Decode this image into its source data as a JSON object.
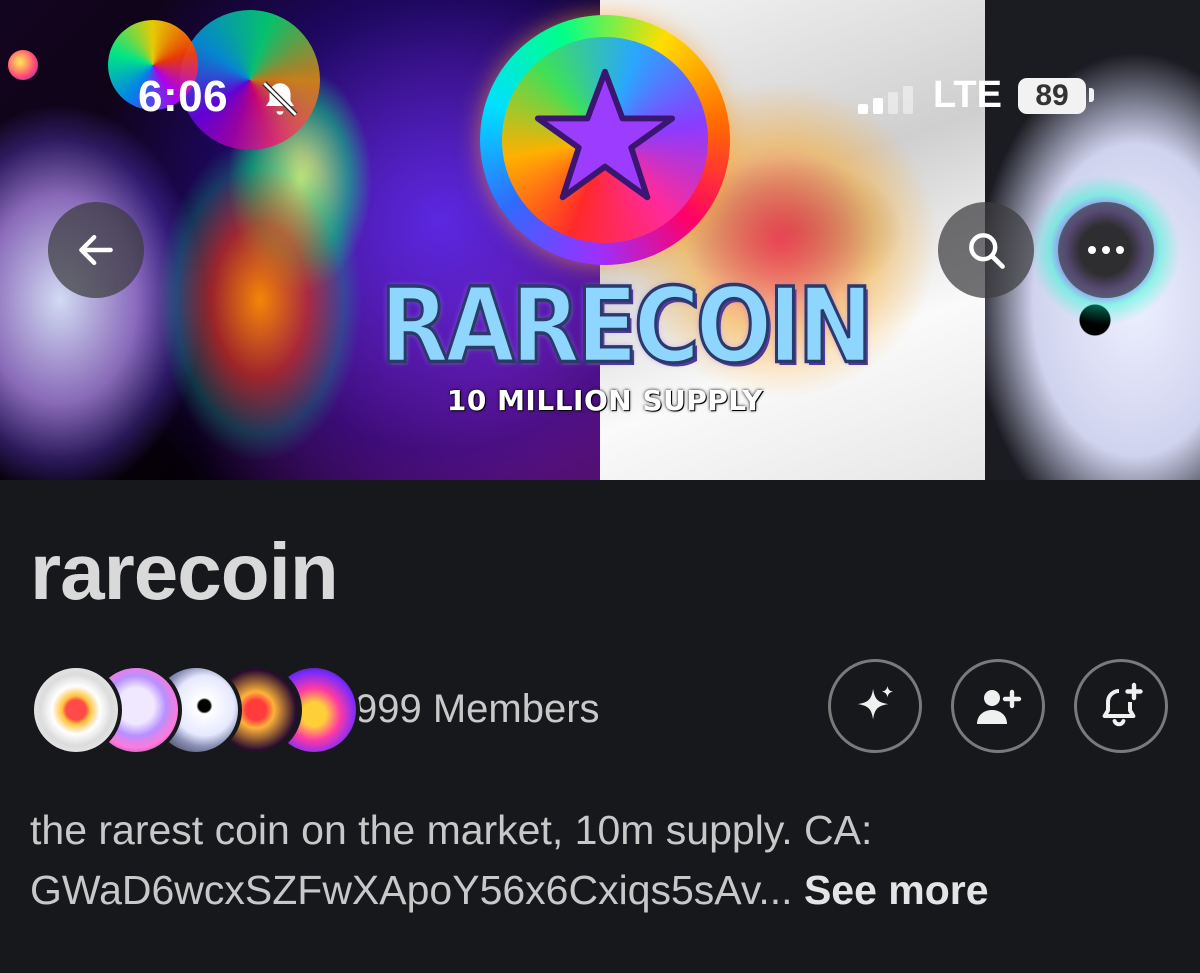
{
  "status_bar": {
    "time": "6:06",
    "network": "LTE",
    "battery": "89"
  },
  "banner": {
    "title": "RARECOIN",
    "subtitle": "10 MILLION SUPPLY"
  },
  "nav": {
    "back_icon": "arrow-left-icon",
    "search_icon": "search-icon",
    "more_icon": "more-horizontal-icon"
  },
  "community": {
    "name": "rarecoin",
    "members_text": "999 Members",
    "description_line1": "the rarest coin on the market, 10m supply. CA:",
    "description_line2": "GWaD6wcxSZFwXApoY56x6Cxiqs5sAv...",
    "see_more": "See more"
  },
  "actions": {
    "sparkle_icon": "sparkle-icon",
    "add_user_icon": "add-user-icon",
    "bell_plus_icon": "bell-plus-icon"
  },
  "colors": {
    "background": "#16181c",
    "text_primary": "#d9d9d9",
    "button_border": "#7a7a7a"
  }
}
